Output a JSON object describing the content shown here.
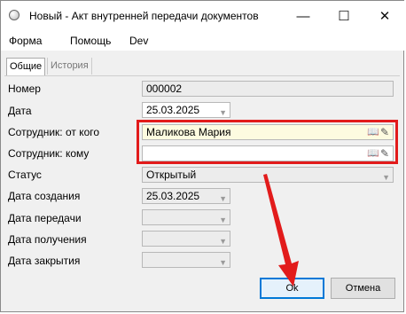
{
  "window": {
    "title": "Новый - Акт внутренней передачи документов",
    "controls": {
      "minimize": "—",
      "maximize": "☐",
      "close": "✕"
    }
  },
  "menu": [
    "Форма",
    "Помощь",
    "Dev"
  ],
  "tabs": [
    "Общие",
    "История"
  ],
  "fields": {
    "number": {
      "label": "Номер",
      "value": "000002"
    },
    "date": {
      "label": "Дата",
      "value": "25.03.2025"
    },
    "employee_from": {
      "label": "Сотрудник: от кого",
      "value": "Маликова Мария"
    },
    "employee_to": {
      "label": "Сотрудник: кому",
      "value": ""
    },
    "status": {
      "label": "Статус",
      "value": "Открытый"
    },
    "created": {
      "label": "Дата создания",
      "value": "25.03.2025"
    },
    "transferred": {
      "label": "Дата передачи",
      "value": ""
    },
    "received": {
      "label": "Дата получения",
      "value": ""
    },
    "closed": {
      "label": "Дата закрытия",
      "value": ""
    }
  },
  "buttons": {
    "ok": "Ok",
    "cancel": "Отмена"
  },
  "colors": {
    "highlight": "#e21b1b",
    "accent": "#0078d7",
    "yellow_field": "#fdfbe0"
  },
  "icons": {
    "lookup": "book-icon",
    "edit": "pencil-icon",
    "dropdown": "chevron-down-icon"
  }
}
